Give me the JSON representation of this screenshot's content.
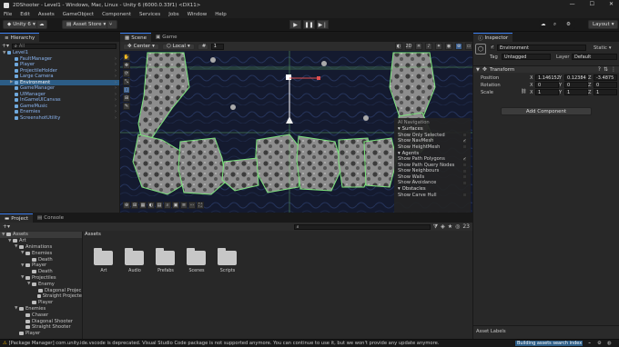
{
  "window": {
    "title": "2DShooter - Level1 - Windows, Mac, Linux - Unity 6 (6000.0.33f1) <DX11>",
    "minimize": "—",
    "maximize": "☐",
    "close": "✕"
  },
  "menu": [
    "File",
    "Edit",
    "Assets",
    "GameObject",
    "Component",
    "Services",
    "Jobs",
    "Window",
    "Help"
  ],
  "toolbar": {
    "account": "Unity 6",
    "asset_store": "Asset Store",
    "layout": "Layout"
  },
  "hierarchy": {
    "tab": "Hierarchy",
    "search_placeholder": "All",
    "rows": [
      {
        "label": "Level1",
        "depth": 0,
        "arrow": "▼"
      },
      {
        "label": "FaultManager",
        "depth": 1,
        "arrow": ""
      },
      {
        "label": "Player",
        "depth": 1,
        "arrow": ""
      },
      {
        "label": "ProjectileHolder",
        "depth": 1,
        "arrow": ""
      },
      {
        "label": "Large Camera",
        "depth": 1,
        "arrow": ""
      },
      {
        "label": "Environment",
        "depth": 1,
        "arrow": "▶"
      },
      {
        "label": "GameManager",
        "depth": 1,
        "arrow": ""
      },
      {
        "label": "UIManager",
        "depth": 1,
        "arrow": ""
      },
      {
        "label": "InGameUICanvas",
        "depth": 1,
        "arrow": ""
      },
      {
        "label": "GameMusic",
        "depth": 1,
        "arrow": ""
      },
      {
        "label": "Enemies",
        "depth": 1,
        "arrow": ""
      },
      {
        "label": "ScreenshotUtility",
        "depth": 1,
        "arrow": ""
      }
    ]
  },
  "scene": {
    "tabs": [
      "Scene",
      "Game"
    ],
    "pivot": "Center",
    "space": "Local",
    "grid_snap": "1"
  },
  "ai_nav": {
    "title": "AI Navigation",
    "sections": [
      {
        "name": "Surfaces",
        "items": [
          {
            "label": "Show Only Selected",
            "checked": false
          },
          {
            "label": "Show NavMesh",
            "checked": true
          },
          {
            "label": "Show HeightMesh",
            "checked": false
          }
        ]
      },
      {
        "name": "Agents",
        "items": [
          {
            "label": "Show Path Polygons",
            "checked": true
          },
          {
            "label": "Show Path Query Nodes",
            "checked": false
          },
          {
            "label": "Show Neighbours",
            "checked": false
          },
          {
            "label": "Show Walls",
            "checked": false
          },
          {
            "label": "Show Avoidance",
            "checked": false
          }
        ]
      },
      {
        "name": "Obstacles",
        "items": [
          {
            "label": "Show Carve Hull",
            "checked": false
          }
        ]
      }
    ]
  },
  "inspector": {
    "tab": "Inspector",
    "object_name": "Environment",
    "static": "Static",
    "tag_label": "Tag",
    "tag_value": "Untagged",
    "layer_label": "Layer",
    "layer_value": "Default",
    "component": "Transform",
    "position": {
      "label": "Position",
      "x": "1.146152",
      "y": "0.12384",
      "z": "-3.4875"
    },
    "rotation": {
      "label": "Rotation",
      "x": "0",
      "y": "0",
      "z": "0"
    },
    "scale": {
      "label": "Scale",
      "x": "1",
      "y": "1",
      "z": "1"
    },
    "add_component": "Add Component",
    "asset_labels": "Asset Labels"
  },
  "project": {
    "tabs": [
      "Project",
      "Console"
    ],
    "breadcrumb": "Assets",
    "count": "23",
    "tree": [
      {
        "label": "Assets",
        "depth": 0,
        "arrow": "▼"
      },
      {
        "label": "Art",
        "depth": 1,
        "arrow": "▼"
      },
      {
        "label": "Animations",
        "depth": 2,
        "arrow": "▼"
      },
      {
        "label": "Enemies",
        "depth": 3,
        "arrow": "▼"
      },
      {
        "label": "Death",
        "depth": 4,
        "arrow": ""
      },
      {
        "label": "Player",
        "depth": 3,
        "arrow": "▼"
      },
      {
        "label": "Death",
        "depth": 4,
        "arrow": ""
      },
      {
        "label": "Projectiles",
        "depth": 3,
        "arrow": "▼"
      },
      {
        "label": "Enemy",
        "depth": 4,
        "arrow": "▼"
      },
      {
        "label": "Diagonal Projec",
        "depth": 5,
        "arrow": ""
      },
      {
        "label": "Straight Projecte",
        "depth": 5,
        "arrow": ""
      },
      {
        "label": "Player",
        "depth": 4,
        "arrow": ""
      },
      {
        "label": "Enemies",
        "depth": 2,
        "arrow": "▼"
      },
      {
        "label": "Chaser",
        "depth": 3,
        "arrow": ""
      },
      {
        "label": "Diagonal Shooter",
        "depth": 3,
        "arrow": ""
      },
      {
        "label": "Straight Shooter",
        "depth": 3,
        "arrow": ""
      },
      {
        "label": "Player",
        "depth": 2,
        "arrow": ""
      }
    ],
    "folders": [
      "Art",
      "Audio",
      "Prefabs",
      "Scenes",
      "Scripts"
    ]
  },
  "status": {
    "message": "[Package Manager] com.unity.ide.vscode is deprecated. Visual Studio Code package is not supported anymore. You can continue to use it, but we won't provide any update anymore.",
    "progress_label": "Building assets search index"
  }
}
